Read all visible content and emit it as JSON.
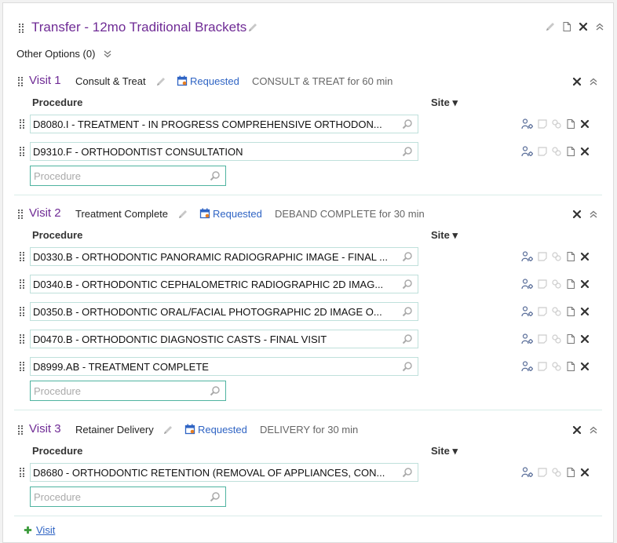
{
  "plan": {
    "title": "Transfer - 12mo Traditional Brackets",
    "other_options": "Other Options (0)"
  },
  "columns": {
    "procedure": "Procedure",
    "site": "Site"
  },
  "procedure_placeholder": "Procedure",
  "visits": [
    {
      "label": "Visit 1",
      "name": "Consult & Treat",
      "status": "Requested",
      "description": "CONSULT & TREAT for 60 min",
      "procedures": [
        "D8080.I - TREATMENT - IN PROGRESS COMPREHENSIVE ORTHODON...",
        "D9310.F - ORTHODONTIST CONSULTATION"
      ]
    },
    {
      "label": "Visit 2",
      "name": "Treatment Complete",
      "status": "Requested",
      "description": "DEBAND COMPLETE for 30 min",
      "procedures": [
        "D0330.B - ORTHODONTIC PANORAMIC RADIOGRAPHIC IMAGE - FINAL ...",
        "D0340.B - ORTHODONTIC CEPHALOMETRIC RADIOGRAPHIC 2D IMAG...",
        "D0350.B - ORTHODONTIC ORAL/FACIAL PHOTOGRAPHIC 2D IMAGE O...",
        "D0470.B - ORTHODONTIC DIAGNOSTIC CASTS - FINAL VISIT",
        "D8999.AB - TREATMENT COMPLETE"
      ]
    },
    {
      "label": "Visit 3",
      "name": "Retainer Delivery",
      "status": "Requested",
      "description": "DELIVERY for 30 min",
      "procedures": [
        "D8680 - ORTHODONTIC RETENTION (REMOVAL OF APPLIANCES, CON..."
      ]
    }
  ],
  "add_visit_label": "Visit",
  "icons": {
    "drag": "drag-handle-icon",
    "edit": "pencil-icon",
    "calendar": "calendar-icon",
    "note": "document-icon",
    "remove": "close-x-icon",
    "collapse": "double-chevron-up-icon",
    "expand": "double-chevron-down-icon",
    "search": "magnifier-icon",
    "provider": "person-gear-icon",
    "add": "plus-icon"
  },
  "colors": {
    "title": "#6f2b95",
    "link": "#2f64c4",
    "add": "#3a9a3a",
    "field_border": "#bfe0db"
  }
}
